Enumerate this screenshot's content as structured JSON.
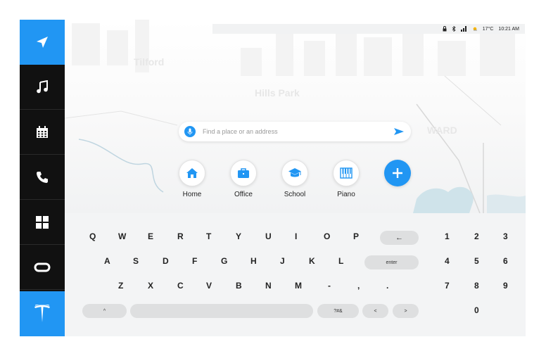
{
  "colors": {
    "accent": "#2196f3",
    "sidebar": "#111111",
    "keyboard_bg": "#f3f4f5",
    "key_pill": "#dedfe0"
  },
  "sidebar": {
    "items": [
      {
        "name": "navigation",
        "icon": "navigation-arrow-icon",
        "active": true
      },
      {
        "name": "music",
        "icon": "music-note-icon"
      },
      {
        "name": "calendar",
        "icon": "calendar-icon"
      },
      {
        "name": "phone",
        "icon": "phone-icon"
      },
      {
        "name": "apps",
        "icon": "apps-grid-icon"
      },
      {
        "name": "vr",
        "icon": "vr-headset-icon"
      },
      {
        "name": "tesla",
        "icon": "tesla-logo-icon",
        "active": true
      }
    ]
  },
  "status": {
    "temperature": "17°C",
    "time": "10:21 AM",
    "icons": [
      "lock-icon",
      "bluetooth-icon",
      "signal-icon",
      "weather-icon"
    ]
  },
  "map": {
    "labels": [
      "Tilford",
      "Hills Park",
      "WARD"
    ]
  },
  "search": {
    "placeholder": "Find a place or an address"
  },
  "shortcuts": [
    {
      "label": "Home",
      "icon": "home-icon"
    },
    {
      "label": "Office",
      "icon": "briefcase-icon"
    },
    {
      "label": "School",
      "icon": "graduation-cap-icon"
    },
    {
      "label": "Piano",
      "icon": "piano-icon"
    }
  ],
  "add_button": {
    "icon": "plus-icon"
  },
  "keyboard": {
    "row1": [
      "Q",
      "W",
      "E",
      "R",
      "T",
      "Y",
      "U",
      "I",
      "O",
      "P"
    ],
    "row2": [
      "A",
      "S",
      "D",
      "F",
      "G",
      "H",
      "J",
      "K",
      "L"
    ],
    "row3": [
      "Z",
      "X",
      "C",
      "V",
      "B",
      "N",
      "M",
      "-",
      ",",
      "."
    ],
    "backspace": "←",
    "enter": "enter",
    "shift": "^",
    "symbols": "?#&",
    "left": "<",
    "right": ">",
    "numpad": [
      "1",
      "2",
      "3",
      "4",
      "5",
      "6",
      "7",
      "8",
      "9",
      "0"
    ]
  }
}
